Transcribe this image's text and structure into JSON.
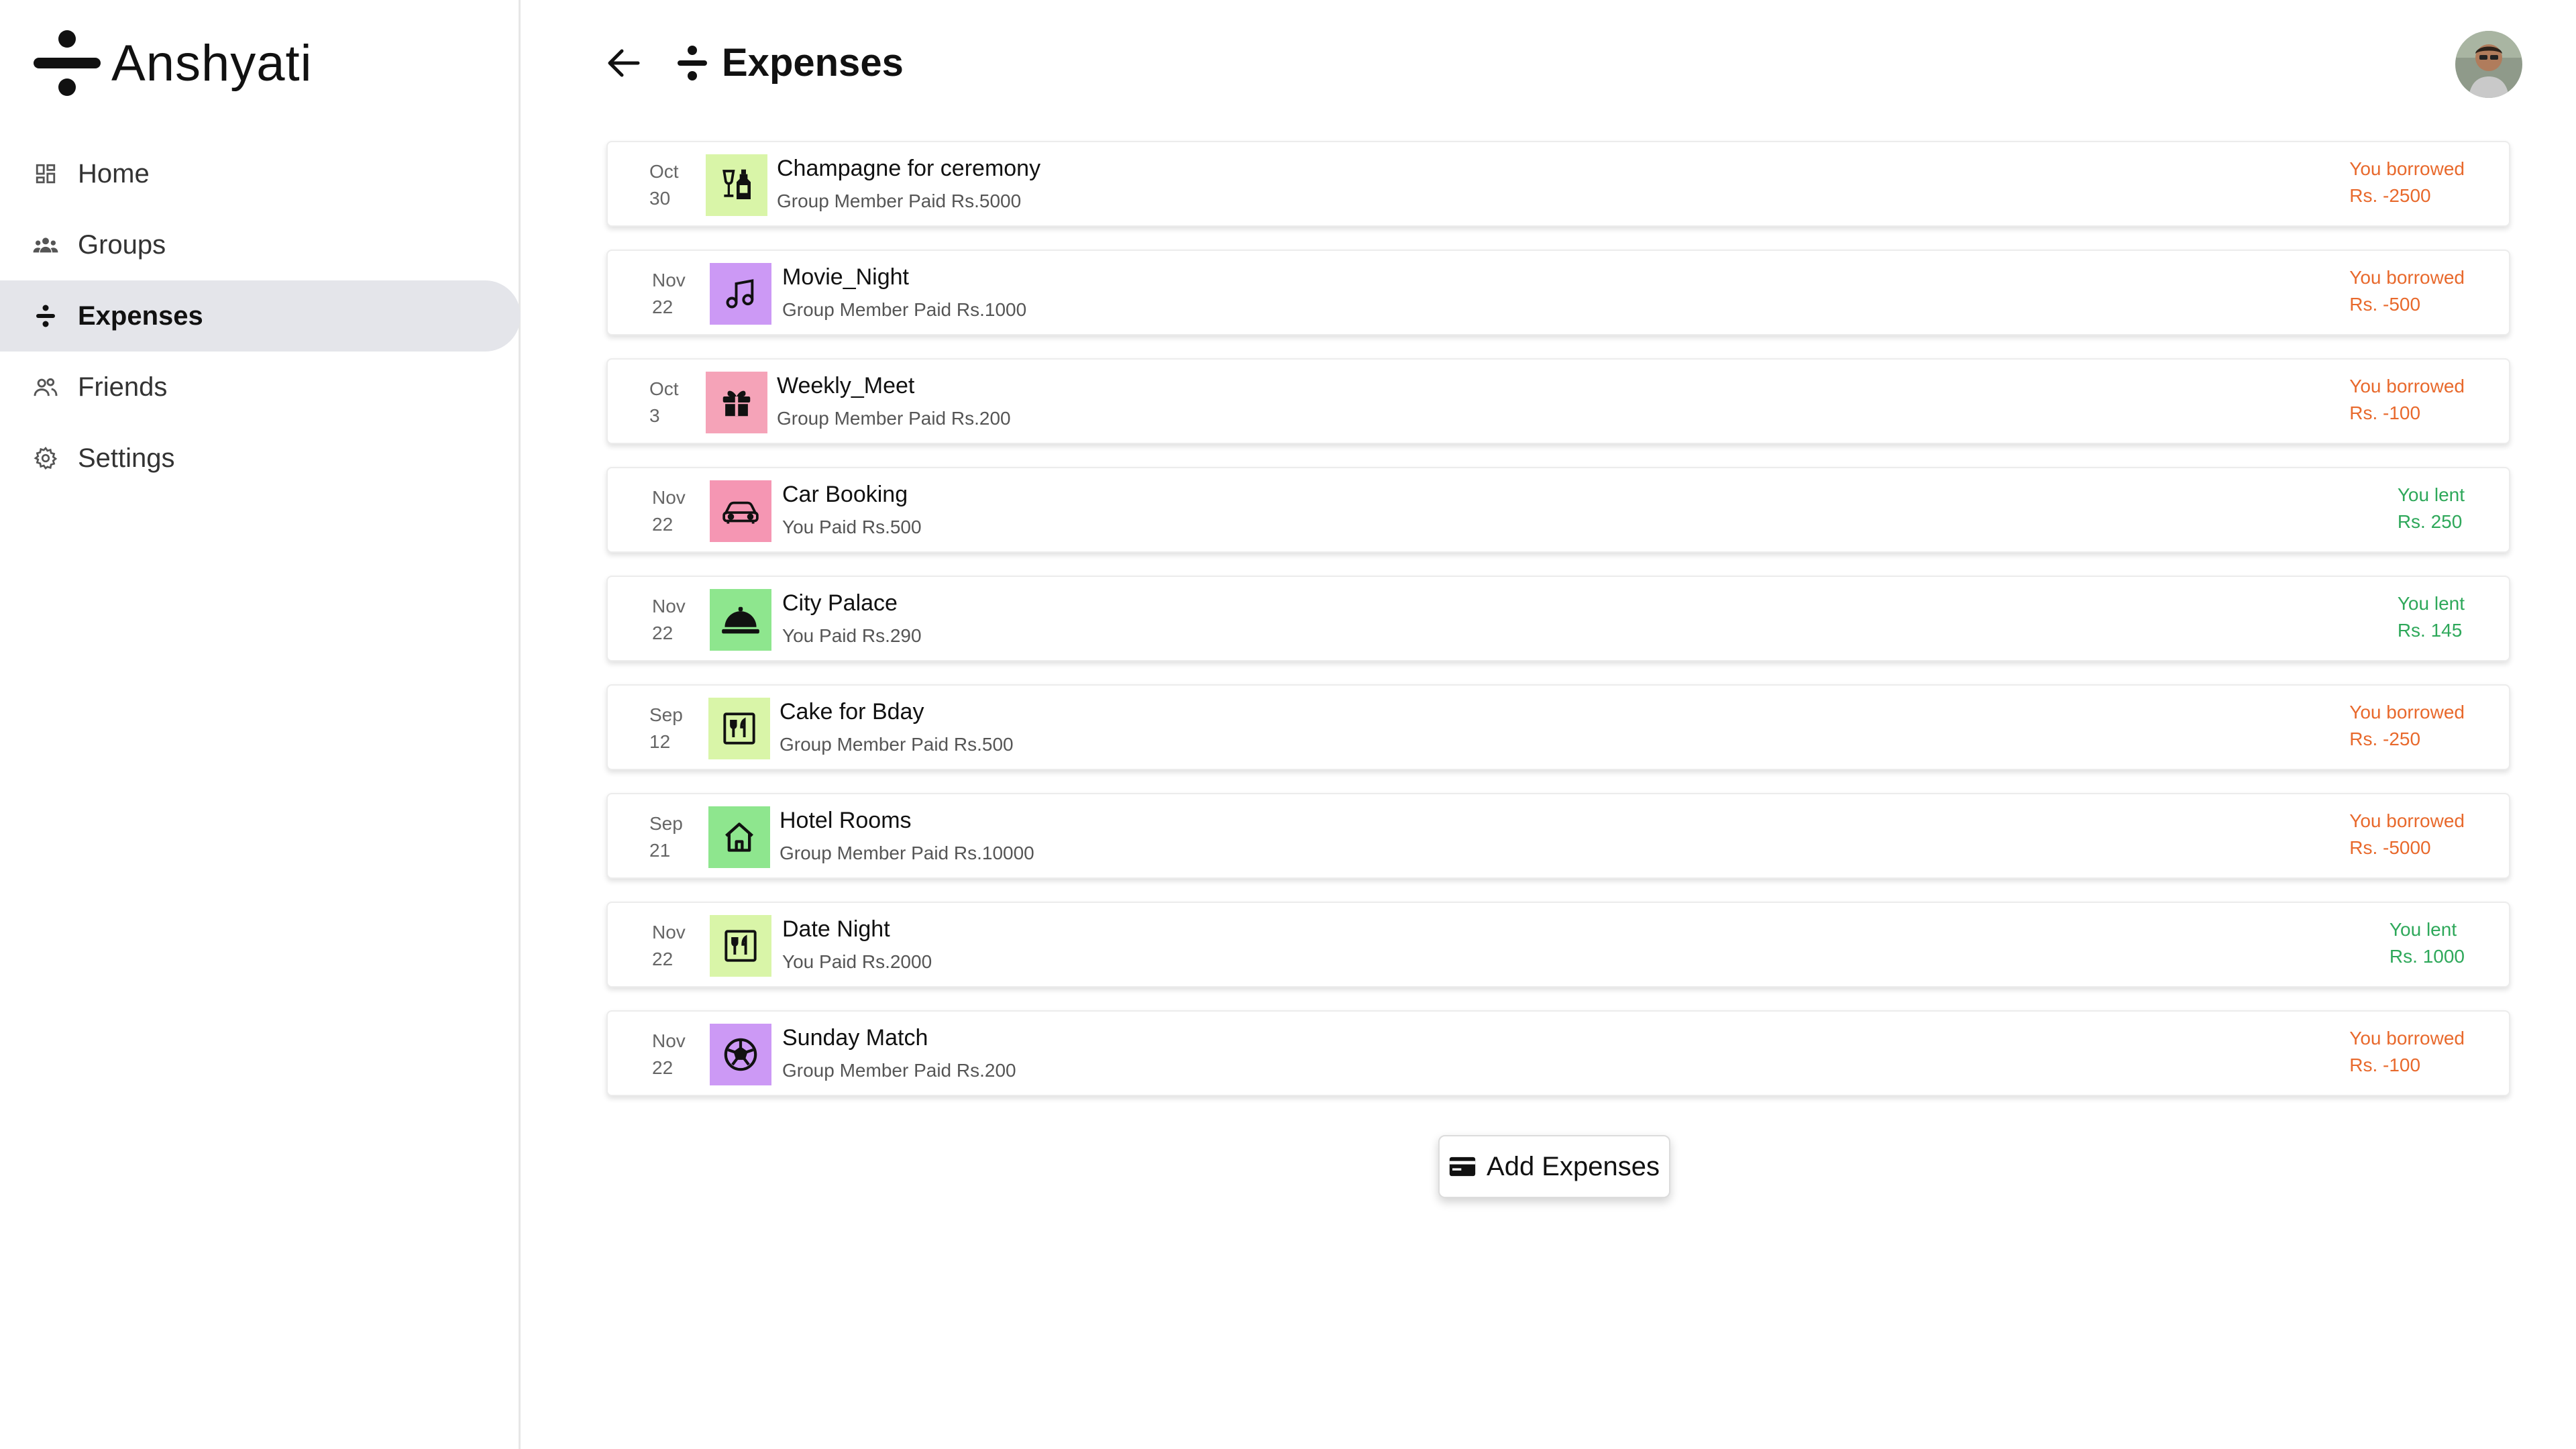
{
  "app": {
    "name": "Anshyati"
  },
  "sidebar": {
    "items": [
      {
        "label": "Home",
        "icon": "grid-icon",
        "active": false
      },
      {
        "label": "Groups",
        "icon": "groups-icon",
        "active": false
      },
      {
        "label": "Expenses",
        "icon": "divide-icon",
        "active": true
      },
      {
        "label": "Friends",
        "icon": "friends-icon",
        "active": false
      },
      {
        "label": "Settings",
        "icon": "gear-icon",
        "active": false
      }
    ]
  },
  "header": {
    "title": "Expenses"
  },
  "expenses": [
    {
      "month": "Oct",
      "day": "30",
      "name": "Champagne for ceremony",
      "sub": "Group Member Paid Rs.5000",
      "status": "You borrowed",
      "amount": "Rs. -2500",
      "type": "borrow",
      "icon": "drinks-icon",
      "color": "#d9f5a8"
    },
    {
      "month": "Nov",
      "day": "22",
      "name": "Movie_Night",
      "sub": "Group Member Paid Rs.1000",
      "status": "You borrowed",
      "amount": "Rs. -500",
      "type": "borrow",
      "icon": "music-note-icon",
      "color": "#cc99f5"
    },
    {
      "month": "Oct",
      "day": "3",
      "name": "Weekly_Meet",
      "sub": "Group Member Paid Rs.200",
      "status": "You borrowed",
      "amount": "Rs. -100",
      "type": "borrow",
      "icon": "gift-icon",
      "color": "#f5a3b8"
    },
    {
      "month": "Nov",
      "day": "22",
      "name": "Car Booking",
      "sub": "You Paid Rs.500",
      "status": "You lent",
      "amount": "Rs. 250",
      "type": "lent",
      "icon": "car-icon",
      "color": "#f596b3"
    },
    {
      "month": "Nov",
      "day": "22",
      "name": "City Palace",
      "sub": "You Paid Rs.290",
      "status": "You lent",
      "amount": "Rs. 145",
      "type": "lent",
      "icon": "service-bell-icon",
      "color": "#8ee68e"
    },
    {
      "month": "Sep",
      "day": "12",
      "name": "Cake for Bday",
      "sub": "Group Member Paid Rs.500",
      "status": "You borrowed",
      "amount": "Rs. -250",
      "type": "borrow",
      "icon": "restaurant-icon",
      "color": "#d9f5a8"
    },
    {
      "month": "Sep",
      "day": "21",
      "name": "Hotel Rooms",
      "sub": "Group Member Paid Rs.10000",
      "status": "You borrowed",
      "amount": "Rs. -5000",
      "type": "borrow",
      "icon": "home-icon",
      "color": "#8ee68e"
    },
    {
      "month": "Nov",
      "day": "22",
      "name": "Date Night",
      "sub": "You Paid Rs.2000",
      "status": "You lent",
      "amount": "Rs. 1000",
      "type": "lent",
      "icon": "restaurant-icon",
      "color": "#d9f5a8"
    },
    {
      "month": "Nov",
      "day": "22",
      "name": "Sunday Match",
      "sub": "Group Member Paid Rs.200",
      "status": "You borrowed",
      "amount": "Rs. -100",
      "type": "borrow",
      "icon": "football-icon",
      "color": "#cc99f5"
    }
  ],
  "actions": {
    "add_label": "Add Expenses",
    "add_icon": "card-icon"
  },
  "colors": {
    "borrow": "#e8692c",
    "lent": "#2ea85a",
    "active_bg": "#e4e5ea"
  }
}
